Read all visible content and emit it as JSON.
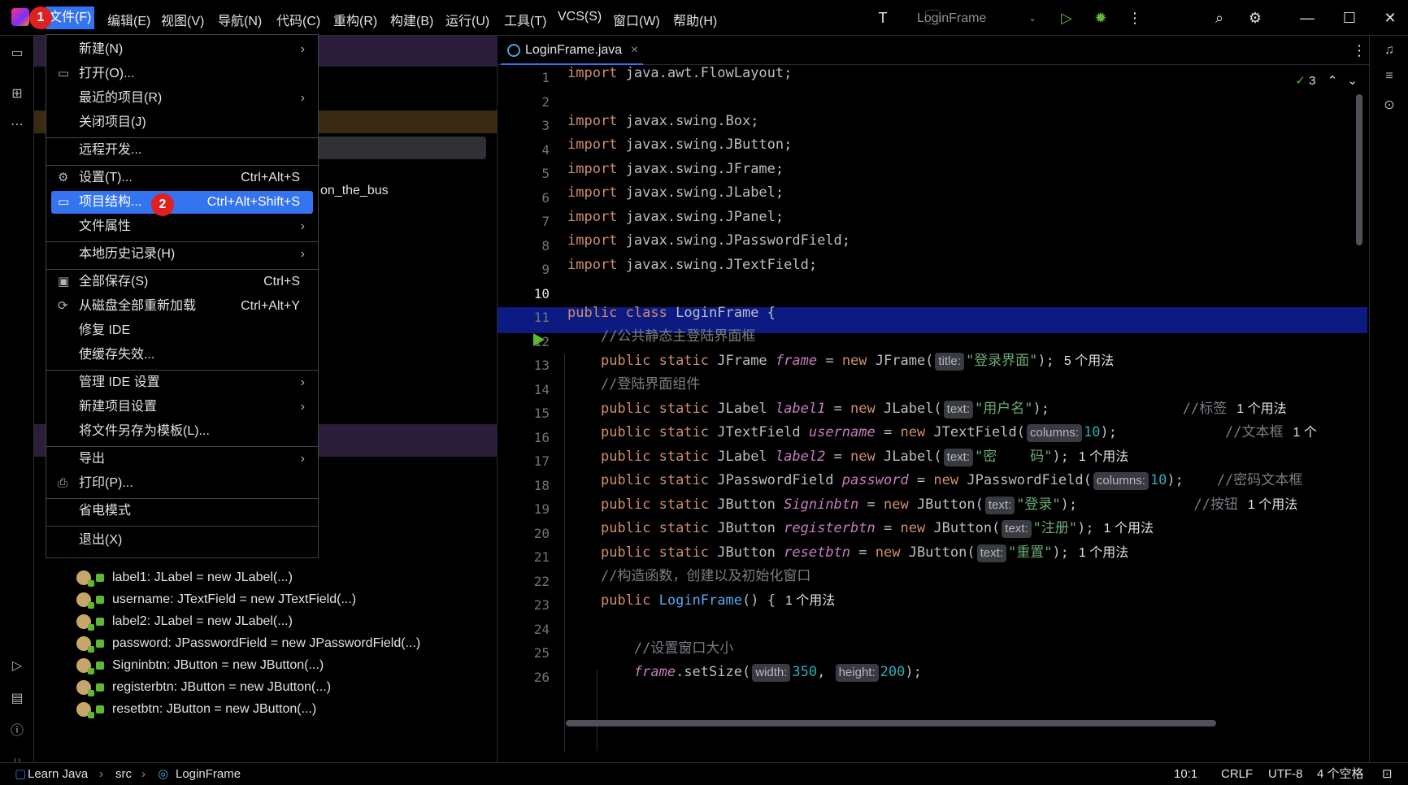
{
  "menubar": {
    "items": [
      "文件(F)",
      "编辑(E)",
      "视图(V)",
      "导航(N)",
      "代码(C)",
      "重构(R)",
      "构建(B)",
      "运行(U)",
      "工具(T)",
      "VCS(S)",
      "窗口(W)",
      "帮助(H)"
    ],
    "project_name": "LoginFrame"
  },
  "file_menu": {
    "items": {
      "new": "新建(N)",
      "open": "打开(O)...",
      "recent": "最近的项目(R)",
      "close": "关闭项目(J)",
      "remote": "远程开发...",
      "settings": "设置(T)...",
      "settings_sc": "Ctrl+Alt+S",
      "project_structure": "项目结构...",
      "project_structure_sc": "Ctrl+Alt+Shift+S",
      "file_props": "文件属性",
      "local_history": "本地历史记录(H)",
      "save_all": "全部保存(S)",
      "save_all_sc": "Ctrl+S",
      "reload": "从磁盘全部重新加载",
      "reload_sc": "Ctrl+Alt+Y",
      "repair": "修复 IDE",
      "invalidate": "使缓存失效...",
      "manage_ide": "管理 IDE 设置",
      "new_project_settings": "新建项目设置",
      "save_template": "将文件另存为模板(L)...",
      "export": "导出",
      "print": "打印(P)...",
      "power_save": "省电模式",
      "exit": "退出(X)"
    }
  },
  "badges": {
    "one": "1",
    "two": "2"
  },
  "project_tree": {
    "partial_label": "on_the_bus",
    "fields": [
      "label1: JLabel = new JLabel(...)",
      "username: JTextField = new JTextField(...)",
      "label2: JLabel = new JLabel(...)",
      "password: JPasswordField = new JPasswordField(...)",
      "Signinbtn: JButton = new JButton(...)",
      "registerbtn: JButton = new JButton(...)",
      "resetbtn: JButton = new JButton(...)"
    ]
  },
  "editor": {
    "tab_label": "LoginFrame.java",
    "inspections_count": "3",
    "line_numbers": [
      "1",
      "2",
      "3",
      "4",
      "5",
      "6",
      "7",
      "8",
      "9",
      "10",
      "11",
      "12",
      "13",
      "14",
      "15",
      "16",
      "17",
      "18",
      "19",
      "20",
      "21",
      "22",
      "23",
      "24",
      "25",
      "26"
    ],
    "imports": [
      "java.awt.FlowLayout;",
      "javax.swing.Box;",
      "javax.swing.JButton;",
      "javax.swing.JFrame;",
      "javax.swing.JLabel;",
      "javax.swing.JPanel;",
      "javax.swing.JPasswordField;",
      "javax.swing.JTextField;"
    ],
    "class_name": "LoginFrame",
    "comment_static_frame": "//公共静态主登陆界面框",
    "comment_components": "//登陆界面组件",
    "comment_ctor": "//构造函数，创建以及初始化窗口",
    "comment_size": "//设置窗口大小",
    "str_title": "\"登录界面\"",
    "str_user": "\"用户名\"",
    "str_pwd": "\"密    码\"",
    "str_login": "\"登录\"",
    "str_register": "\"注册\"",
    "str_reset": "\"重置\"",
    "cmt_label": "//标签",
    "cmt_textbox": "//文本框",
    "cmt_pwdbox": "//密码文本框",
    "cmt_button": "//按钮",
    "usages_5": "5 个用法",
    "usages_1": "1 个用法",
    "usages_1_cut": "1 个",
    "hint_title": "title:",
    "hint_text": "text:",
    "hint_columns": "columns:",
    "hint_width": "width:",
    "hint_height": "height:",
    "num_10": "10",
    "num_350": "350",
    "num_200": "200"
  },
  "statusbar": {
    "breadcrumb": [
      "Learn Java",
      "src",
      "LoginFrame"
    ],
    "position": "10:1",
    "line_sep": "CRLF",
    "encoding": "UTF-8",
    "indent": "4 个空格"
  }
}
